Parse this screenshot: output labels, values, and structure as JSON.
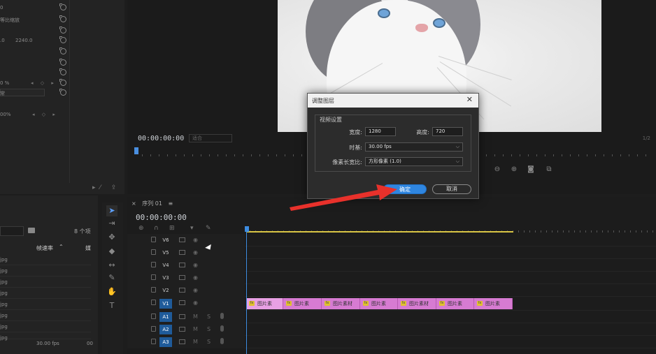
{
  "effect_controls": {
    "rows": [
      {
        "v1": "0",
        "v2": "",
        "reset": true
      },
      {
        "v1": "等比缩放",
        "v2": "",
        "reset": true
      },
      {
        "v1": "",
        "v2": "",
        "reset": true
      },
      {
        "v1": ".0",
        "v2": "2240.0",
        "reset": true
      },
      {
        "v1": "",
        "v2": "",
        "reset": true
      },
      {
        "v1": "",
        "v2": "",
        "reset": true
      },
      {
        "v1": "",
        "v2": "",
        "reset": true
      },
      {
        "v1": "0 %",
        "v2": "",
        "reset": true
      },
      {
        "v1": "常",
        "v2": "",
        "reset": true
      },
      {
        "v1": "",
        "v2": "",
        "reset": true
      },
      {
        "v1": "00%",
        "v2": "",
        "reset": false
      }
    ]
  },
  "monitor": {
    "timecode": "00:00:00:00",
    "fit_label": "适合",
    "fraction": "1/2"
  },
  "dialog": {
    "title": "调整图层",
    "close": "✕",
    "section_title": "视频设置",
    "width_label": "宽度:",
    "width_value": "1280",
    "height_label": "高度:",
    "height_value": "720",
    "timebase_label": "时基:",
    "timebase_value": "30.00 fps",
    "par_label": "像素长宽比:",
    "par_value": "方形像素 (1.0)",
    "ok_label": "确定",
    "cancel_label": "取消"
  },
  "project": {
    "item_count": "8 个项",
    "col_framerate": "帧速率",
    "col_next": "媒",
    "rows": [
      "jpg",
      "jpg",
      "jpg",
      "jpg",
      "jpg",
      "jpg",
      "jpg",
      "jpg"
    ],
    "footer_fps": "30.00 fps",
    "footer_next": "00"
  },
  "timeline": {
    "tab_close": "×",
    "tab_label": "序列 01",
    "tab_menu": "≡",
    "timecode": "00:00:00:00",
    "video_tracks": [
      "V6",
      "V5",
      "V4",
      "V3",
      "V2",
      "V1"
    ],
    "audio_tracks": [
      "A1",
      "A2",
      "A3"
    ],
    "audio_m": "M",
    "audio_s": "S",
    "clips": [
      "图片素",
      "图片素",
      "图片素材",
      "图片素",
      "图片素材",
      "图片素",
      "图片素"
    ]
  },
  "colors": {
    "accent_blue": "#2f86e0",
    "clip_pink": "#d77bd2",
    "arrow_red": "#e8312b",
    "workarea_yellow": "#d8c544"
  }
}
